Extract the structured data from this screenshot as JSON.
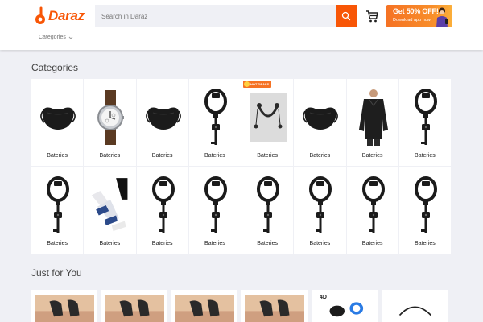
{
  "header": {
    "brand": "Daraz",
    "search": {
      "placeholder": "Search in Daraz"
    },
    "promo": {
      "title": "Get 50% OFF!",
      "subtitle": "Download app now"
    },
    "categories_dropdown": "Categories"
  },
  "sections": {
    "categories_title": "Categories",
    "just_for_you_title": "Just for You"
  },
  "categories": [
    {
      "label": "Bateries",
      "icon": "black-mask-icon"
    },
    {
      "label": "Bateries",
      "icon": "wrist-watch-icon"
    },
    {
      "label": "Bateries",
      "icon": "black-mask-icon"
    },
    {
      "label": "Bateries",
      "icon": "ring-light-icon"
    },
    {
      "label": "Bateries",
      "icon": "neckband-earphone-icon",
      "badge": "HOT DEALS"
    },
    {
      "label": "Bateries",
      "icon": "black-mask-icon"
    },
    {
      "label": "Bateries",
      "icon": "black-sweater-icon"
    },
    {
      "label": "Bateries",
      "icon": "ring-light-icon"
    },
    {
      "label": "Bateries",
      "icon": "ring-light-icon"
    },
    {
      "label": "Bateries",
      "icon": "socks-icon"
    },
    {
      "label": "Bateries",
      "icon": "ring-light-icon"
    },
    {
      "label": "Bateries",
      "icon": "ring-light-icon"
    },
    {
      "label": "Bateries",
      "icon": "ring-light-icon"
    },
    {
      "label": "Bateries",
      "icon": "ring-light-icon"
    },
    {
      "label": "Bateries",
      "icon": "ring-light-icon"
    },
    {
      "label": "Bateries",
      "icon": "ring-light-icon"
    }
  ],
  "just_for_you": [
    {
      "icon": "shoes-photo"
    },
    {
      "icon": "shoes-photo"
    },
    {
      "icon": "shoes-photo"
    },
    {
      "icon": "shoes-photo"
    },
    {
      "icon": "earbud-photo",
      "badge": "4D"
    },
    {
      "icon": "earphone-photo"
    }
  ],
  "colors": {
    "accent": "#f85606",
    "background": "#eff0f5"
  }
}
